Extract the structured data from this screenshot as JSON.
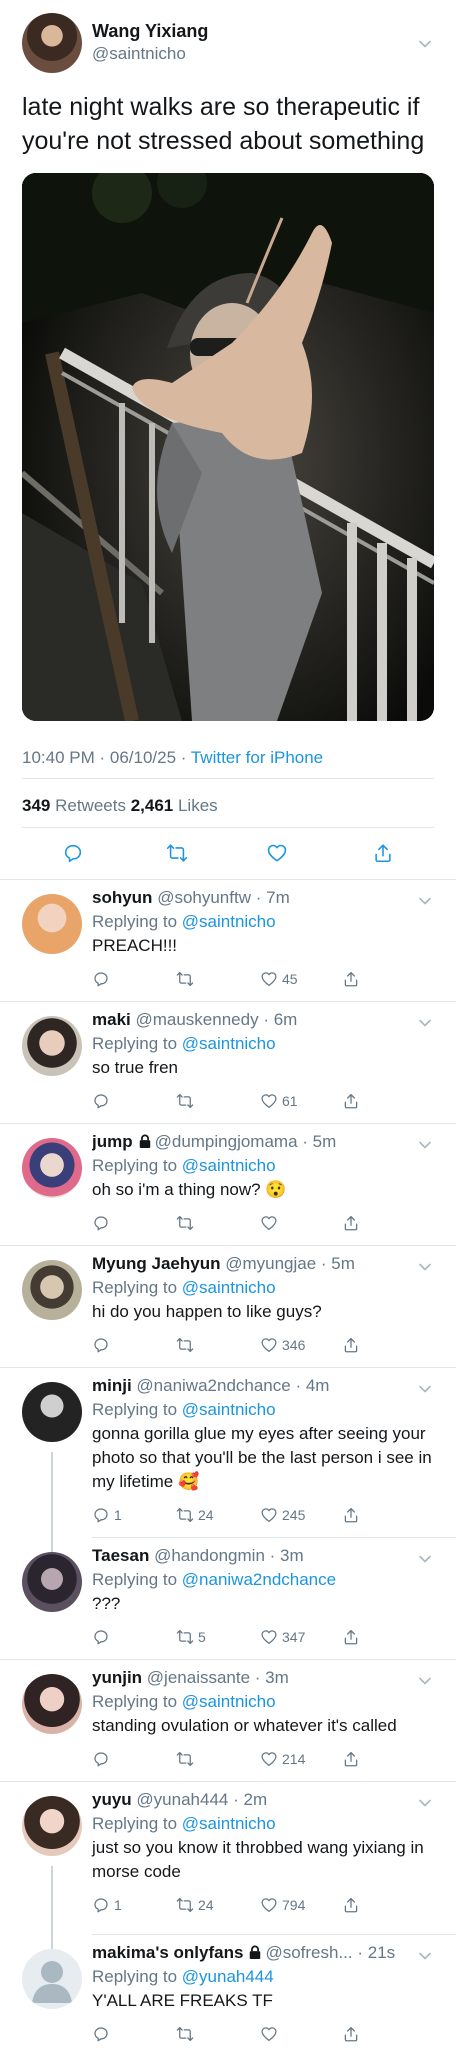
{
  "tweet": {
    "author_name": "Wang Yixiang",
    "author_handle": "@saintnicho",
    "text": "late night walks are so therapeutic if you're not stressed about something",
    "time": "10:40 PM · 06/10/25 · ",
    "source": "Twitter for iPhone",
    "retweets": "349",
    "retweets_label": " Retweets ",
    "likes": "2,461",
    "likes_label": " Likes",
    "actions": [
      "reply-icon",
      "retweet-icon",
      "like-icon",
      "share-icon"
    ]
  },
  "replies": [
    {
      "name": "sohyun",
      "handle": "@sohyunftw",
      "time": "7m",
      "replying_to": "@saintnicho",
      "text": "PREACH!!!",
      "reply_count": "",
      "retweet_count": "",
      "like_count": "45",
      "emoji": ""
    },
    {
      "name": "maki",
      "handle": "@mauskennedy",
      "time": "6m",
      "replying_to": "@saintnicho",
      "text": "so true fren",
      "reply_count": "",
      "retweet_count": "",
      "like_count": "61",
      "emoji": ""
    },
    {
      "name": "jump",
      "handle": "@dumpingjomama",
      "time": "5m",
      "replying_to": "@saintnicho",
      "text": "oh so i'm a thing now?",
      "reply_count": "",
      "retweet_count": "",
      "like_count": "",
      "emoji": "😯",
      "locked": true
    },
    {
      "name": "Myung Jaehyun",
      "handle": "@myungjae",
      "time": "5m",
      "replying_to": "@saintnicho",
      "text": "hi do you happen to like guys?",
      "reply_count": "",
      "retweet_count": "",
      "like_count": "346",
      "emoji": ""
    },
    {
      "name": "minji",
      "handle": "@naniwa2ndchance",
      "time": "4m",
      "replying_to": "@saintnicho",
      "text": "gonna gorilla glue my eyes after seeing your photo so that you'll be the last person i see in my lifetime",
      "reply_count": "1",
      "retweet_count": "24",
      "like_count": "245",
      "emoji": "🥰"
    },
    {
      "name": "Taesan",
      "handle": "@handongmin",
      "time": "3m",
      "replying_to": "@naniwa2ndchance",
      "text": "???",
      "reply_count": "",
      "retweet_count": "5",
      "like_count": "347",
      "emoji": ""
    },
    {
      "name": "yunjin",
      "handle": "@jenaissante",
      "time": "3m",
      "replying_to": "@saintnicho",
      "text": "standing ovulation or whatever it's called",
      "reply_count": "",
      "retweet_count": "",
      "like_count": "214",
      "emoji": ""
    },
    {
      "name": "yuyu",
      "handle": "@yunah444",
      "time": "2m",
      "replying_to": "@saintnicho",
      "text": "just so you know it throbbed wang yixiang in morse code",
      "reply_count": "1",
      "retweet_count": "24",
      "like_count": "794",
      "emoji": ""
    },
    {
      "name": "makima's onlyfans",
      "handle": "@sofresh...",
      "time": "21s",
      "replying_to": "@yunah444",
      "text": "Y'ALL ARE FREAKS TF",
      "reply_count": "",
      "retweet_count": "",
      "like_count": "",
      "emoji": "",
      "locked": true
    }
  ],
  "ui": {
    "replying_prefix": "Replying to ",
    "dot": " · "
  },
  "colors": {
    "text": "#14171a",
    "secondary": "#657786",
    "link": "#1b95e0",
    "divider": "#e1e8ed",
    "thread": "#ccd6dd"
  }
}
